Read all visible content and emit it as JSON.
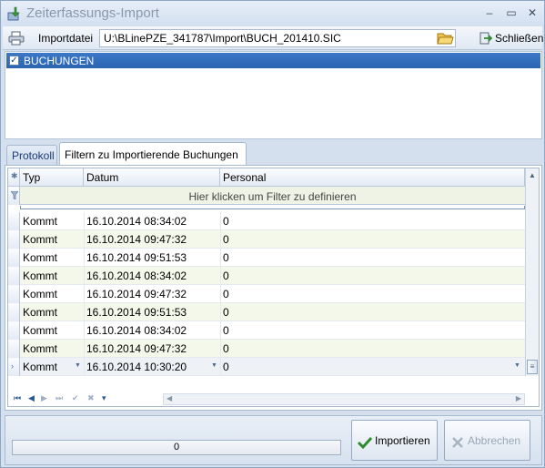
{
  "window": {
    "title": "Zeiterfassungs-Import",
    "controls": [
      "–",
      "▭",
      "✕"
    ]
  },
  "toolbar": {
    "import_label": "Importdatei",
    "path_value": "U:\\BLinePZE_341787\\Import\\BUCH_201410.SIC",
    "close_label": "Schließen"
  },
  "tree": {
    "items": [
      {
        "label": "BUCHUNGEN",
        "checked": true
      }
    ]
  },
  "tabs": [
    {
      "label": "Protokoll",
      "active": false
    },
    {
      "label": "Filtern zu Importierende Buchungen",
      "active": true
    }
  ],
  "grid": {
    "columns": [
      "Typ",
      "Datum",
      "Personal"
    ],
    "filter_hint": "Hier klicken um Filter zu definieren",
    "rows": [
      {
        "typ": "Kommt",
        "datum": "16.10.2014 08:34:02",
        "personal": "0"
      },
      {
        "typ": "Kommt",
        "datum": "16.10.2014 09:47:32",
        "personal": "0"
      },
      {
        "typ": "Kommt",
        "datum": "16.10.2014 09:51:53",
        "personal": "0"
      },
      {
        "typ": "Kommt",
        "datum": "16.10.2014 08:34:02",
        "personal": "0"
      },
      {
        "typ": "Kommt",
        "datum": "16.10.2014 09:47:32",
        "personal": "0"
      },
      {
        "typ": "Kommt",
        "datum": "16.10.2014 09:51:53",
        "personal": "0"
      },
      {
        "typ": "Kommt",
        "datum": "16.10.2014 08:34:02",
        "personal": "0"
      },
      {
        "typ": "Kommt",
        "datum": "16.10.2014 09:47:32",
        "personal": "0"
      }
    ],
    "current_row": {
      "typ": "Kommt",
      "datum": "16.10.2014 10:30:20",
      "personal": "0"
    }
  },
  "footer": {
    "progress_text": "0",
    "progress_value": 0,
    "import_label": "Importieren",
    "cancel_label": "Abbrechen"
  },
  "colors": {
    "selection": "#2c64b1",
    "accent_green": "#2f8a2f",
    "disabled": "#9aa6b5"
  }
}
